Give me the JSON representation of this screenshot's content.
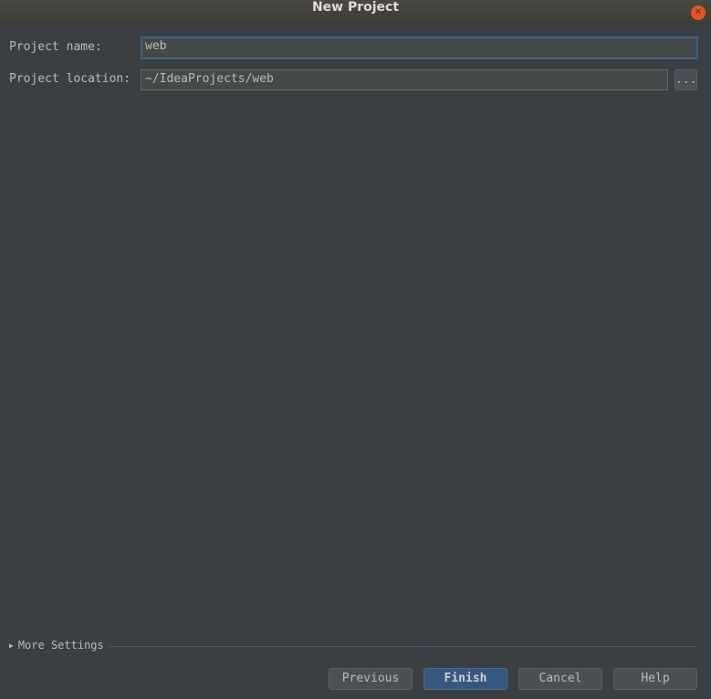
{
  "window": {
    "title": "New Project"
  },
  "form": {
    "name_label": "Project name:",
    "name_value": "web",
    "location_label": "Project location:",
    "location_value": "~/IdeaProjects/web",
    "browse_label": "..."
  },
  "more_settings": "More Settings",
  "buttons": {
    "previous": "Previous",
    "finish": "Finish",
    "cancel": "Cancel",
    "help": "Help"
  }
}
